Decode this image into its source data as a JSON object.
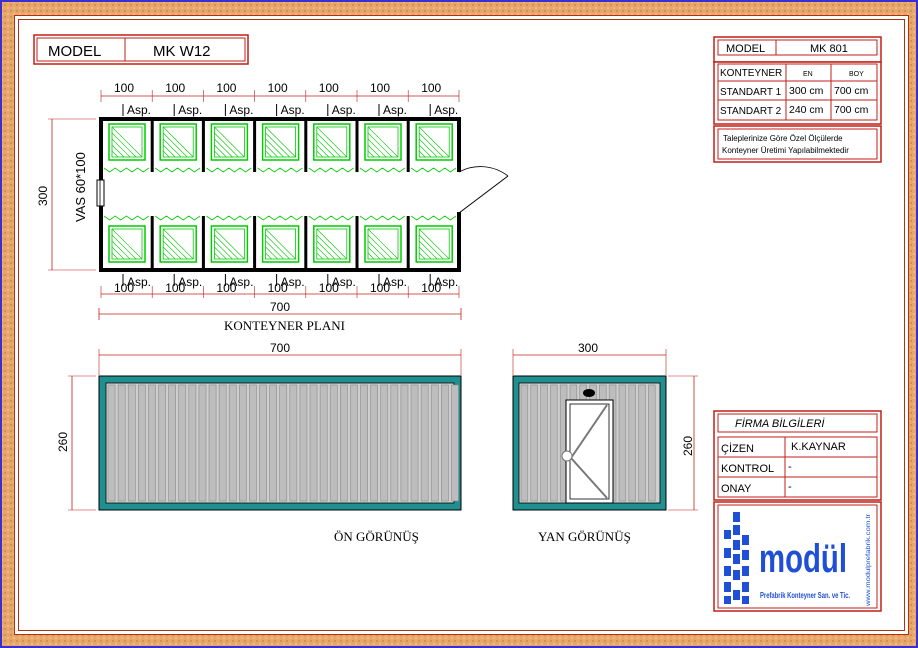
{
  "model_box": {
    "label": "MODEL",
    "value": "MK W12"
  },
  "spec_box": {
    "model_label": "MODEL",
    "model_value": "MK 801",
    "header": {
      "col1": "KONTEYNER",
      "col2": "EN",
      "col3": "BOY"
    },
    "rows": [
      {
        "name": "STANDART 1",
        "en": "300 cm",
        "boy": "700 cm"
      },
      {
        "name": "STANDART 2",
        "en": "240 cm",
        "boy": "700 cm"
      }
    ],
    "note_line1": "Taleplerinize Göre Özel Ölçülerde",
    "note_line2": "Konteyner Üretimi Yapılabilmektedir"
  },
  "plan": {
    "top_dims": [
      "100",
      "100",
      "100",
      "100",
      "100",
      "100",
      "100"
    ],
    "bottom_dims": [
      "100",
      "100",
      "100",
      "100",
      "100",
      "100",
      "100"
    ],
    "asp_label": "Asp.",
    "cabins": 7,
    "total_width": "700",
    "height_dim": "300",
    "sink_label": "VAS 60*100",
    "title": "KONTEYNER PLANI"
  },
  "front_view": {
    "width_dim": "700",
    "height_dim": "260",
    "title": "ÖN  GÖRÜNÜŞ"
  },
  "side_view": {
    "width_dim": "300",
    "height_dim": "260",
    "title": "YAN  GÖRÜNÜŞ"
  },
  "firm_box": {
    "title": "FİRMA BİLGİLERİ",
    "rows": [
      {
        "label": "ÇİZEN",
        "value": "K.KAYNAR"
      },
      {
        "label": "KONTROL",
        "value": "-"
      },
      {
        "label": "ONAY",
        "value": "-"
      }
    ]
  },
  "logo": {
    "brand": "modül",
    "tagline": "Prefabrik Konteyner San. ve Tic.",
    "url": "www.modulprefabrik.com.tr"
  },
  "colors": {
    "green": "#00cc00",
    "teal": "#1f8f8f",
    "red": "#c0201a",
    "panel": "#bdbdbd"
  }
}
